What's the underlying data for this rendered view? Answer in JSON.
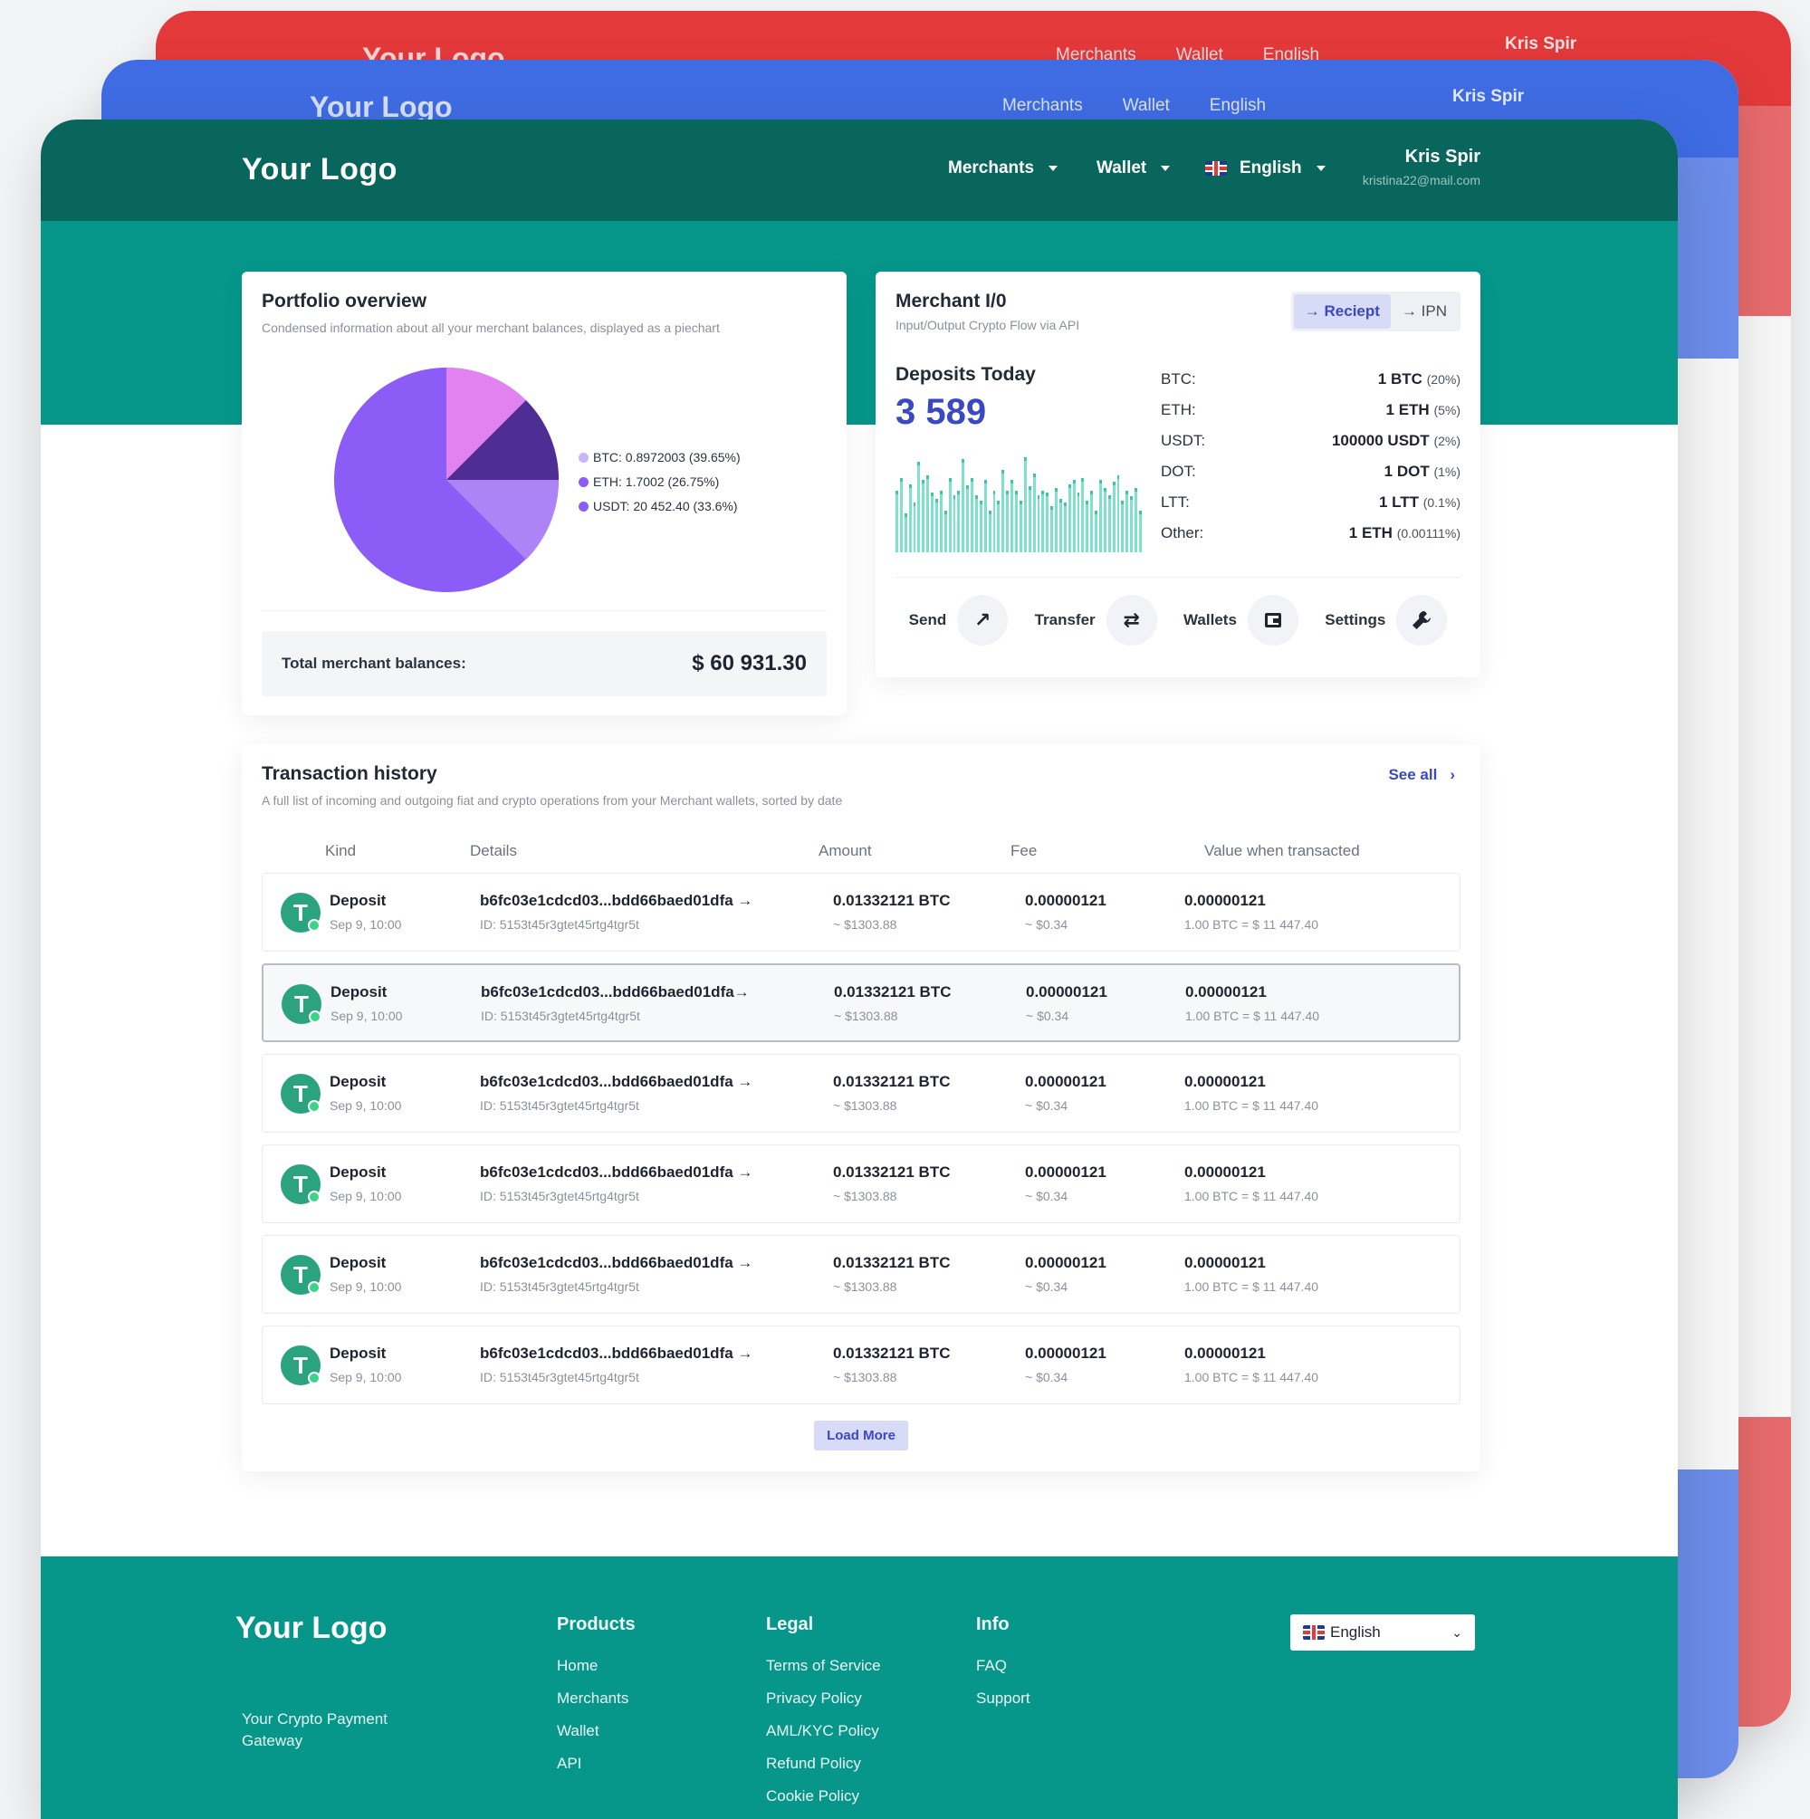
{
  "brand": {
    "logo": "Your Logo",
    "primary": "#08665c",
    "accent": "#06978a",
    "link": "#3a49c2"
  },
  "nav": {
    "merchants": "Merchants",
    "wallet": "Wallet",
    "language": "English"
  },
  "user": {
    "name": "Kris Spir",
    "email": "kristina22@mail.com"
  },
  "portfolio": {
    "title": "Portfolio overview",
    "subtitle": "Condensed information about all your merchant balances, displayed as a piechart",
    "legend": [
      "BTC: 0.8972003 (39.65%)",
      "ETH: 1.7002 (26.75%)",
      "USDT: 20 452.40 (33.6%)"
    ],
    "total_label": "Total merchant balances:",
    "total_value": "$ 60 931.30"
  },
  "merchant": {
    "title": "Merchant I/0",
    "subtitle": "Input/Output Crypto Flow via API",
    "tab_receipt": "→ Reciept",
    "tab_ipn": "→ IPN",
    "deposits_title": "Deposits Today",
    "deposits_value": "3 589",
    "rows": [
      {
        "k": "BTC:",
        "v": "1 BTC",
        "p": "(20%)"
      },
      {
        "k": "ETH:",
        "v": "1 ETH",
        "p": "(5%)"
      },
      {
        "k": "USDT:",
        "v": "100000 USDT",
        "p": "(2%)"
      },
      {
        "k": "DOT:",
        "v": "1 DOT",
        "p": "(1%)"
      },
      {
        "k": "LTT:",
        "v": "1 LTT",
        "p": "(0.1%)"
      },
      {
        "k": "Other:",
        "v": "1 ETH",
        "p": "(0.00111%)"
      }
    ],
    "actions": {
      "send": "Send",
      "transfer": "Transfer",
      "wallets": "Wallets",
      "settings": "Settings"
    }
  },
  "chart_data": {
    "type": "bar",
    "title": "Deposits Today",
    "values": [
      60,
      72,
      38,
      66,
      48,
      88,
      70,
      75,
      58,
      52,
      60,
      40,
      72,
      55,
      60,
      90,
      65,
      72,
      55,
      50,
      70,
      40,
      60,
      50,
      80,
      60,
      70,
      60,
      50,
      92,
      64,
      76,
      55,
      60,
      58,
      45,
      62,
      52,
      48,
      66,
      70,
      58,
      72,
      50,
      60,
      40,
      70,
      62,
      55,
      68,
      75,
      50,
      60,
      54,
      62,
      40
    ]
  },
  "transactions": {
    "title": "Transaction history",
    "subtitle": "A full list of incoming and outgoing fiat and crypto operations from your Merchant wallets, sorted by date",
    "see_all": "See all",
    "headers": {
      "kind": "Kind",
      "details": "Details",
      "amount": "Amount",
      "fee": "Fee",
      "value": "Value when transacted"
    },
    "coin_glyph": "T",
    "rows": [
      {
        "kind": "Deposit",
        "date": "Sep 9, 10:00",
        "hash": "b6fc03e1cdcd03...bdd66baed01dfa →",
        "id": "ID: 5153t45r3gtet45rtg4tgr5t",
        "amount": "0.01332121 BTC",
        "amount_usd": "~ $1303.88",
        "fee": "0.00000121",
        "fee_usd": "~ $0.34",
        "value": "0.00000121",
        "rate": "1.00 BTC = $ 11 447.40"
      },
      {
        "kind": "Deposit",
        "date": "Sep 9, 10:00",
        "hash": "b6fc03e1cdcd03...bdd66baed01dfa→",
        "id": "ID: 5153t45r3gtet45rtg4tgr5t",
        "amount": "0.01332121 BTC",
        "amount_usd": "~ $1303.88",
        "fee": "0.00000121",
        "fee_usd": "~ $0.34",
        "value": "0.00000121",
        "rate": "1.00 BTC = $ 11 447.40"
      },
      {
        "kind": "Deposit",
        "date": "Sep 9, 10:00",
        "hash": "b6fc03e1cdcd03...bdd66baed01dfa →",
        "id": "ID: 5153t45r3gtet45rtg4tgr5t",
        "amount": "0.01332121 BTC",
        "amount_usd": "~ $1303.88",
        "fee": "0.00000121",
        "fee_usd": "~ $0.34",
        "value": "0.00000121",
        "rate": "1.00 BTC = $ 11 447.40"
      },
      {
        "kind": "Deposit",
        "date": "Sep 9, 10:00",
        "hash": "b6fc03e1cdcd03...bdd66baed01dfa →",
        "id": "ID: 5153t45r3gtet45rtg4tgr5t",
        "amount": "0.01332121 BTC",
        "amount_usd": "~ $1303.88",
        "fee": "0.00000121",
        "fee_usd": "~ $0.34",
        "value": "0.00000121",
        "rate": "1.00 BTC = $ 11 447.40"
      },
      {
        "kind": "Deposit",
        "date": "Sep 9, 10:00",
        "hash": "b6fc03e1cdcd03...bdd66baed01dfa →",
        "id": "ID: 5153t45r3gtet45rtg4tgr5t",
        "amount": "0.01332121 BTC",
        "amount_usd": "~ $1303.88",
        "fee": "0.00000121",
        "fee_usd": "~ $0.34",
        "value": "0.00000121",
        "rate": "1.00 BTC = $ 11 447.40"
      },
      {
        "kind": "Deposit",
        "date": "Sep 9, 10:00",
        "hash": "b6fc03e1cdcd03...bdd66baed01dfa →",
        "id": "ID: 5153t45r3gtet45rtg4tgr5t",
        "amount": "0.01332121 BTC",
        "amount_usd": "~ $1303.88",
        "fee": "0.00000121",
        "fee_usd": "~ $0.34",
        "value": "0.00000121",
        "rate": "1.00 BTC = $ 11 447.40"
      }
    ],
    "load_more": "Load More"
  },
  "footer": {
    "logo": "Your Logo",
    "tagline": "Your Crypto Payment Gateway",
    "products": {
      "title": "Products",
      "links": [
        "Home",
        "Merchants",
        "Wallet",
        "API"
      ]
    },
    "legal": {
      "title": "Legal",
      "links": [
        "Terms of Service",
        "Privacy Policy",
        "AML/KYC Policy",
        "Refund Policy",
        "Cookie Policy"
      ]
    },
    "info": {
      "title": "Info",
      "links": [
        "FAQ",
        "Support"
      ]
    },
    "language": "English"
  }
}
